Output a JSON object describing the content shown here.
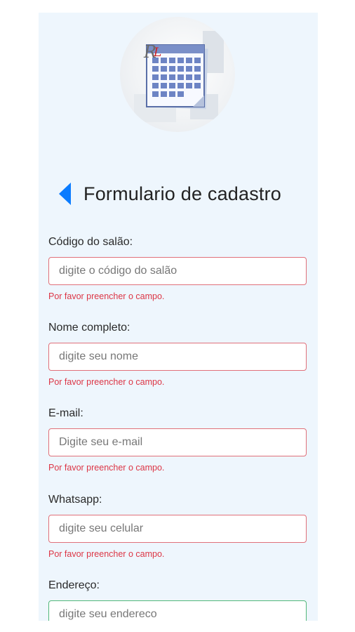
{
  "header": {
    "title": "Formulario de cadastro"
  },
  "logo": {
    "letters": "RL"
  },
  "colors": {
    "accent": "#0b7cff",
    "error": "#dc3545",
    "invalid_border": "#e0707a",
    "valid_border": "#52b87a",
    "panel": "#eef6fd"
  },
  "fields": [
    {
      "label": "Código do salão:",
      "placeholder": "digite o código do salão",
      "error": "Por favor preencher o campo."
    },
    {
      "label": "Nome completo:",
      "placeholder": "digite seu nome",
      "error": "Por favor preencher o campo."
    },
    {
      "label": "E-mail:",
      "placeholder": "Digite seu e-mail",
      "error": "Por favor preencher o campo."
    },
    {
      "label": "Whatsapp:",
      "placeholder": "digite seu celular",
      "error": "Por favor preencher o campo."
    },
    {
      "label": "Endereço:",
      "placeholder": "digite seu endereco"
    }
  ]
}
